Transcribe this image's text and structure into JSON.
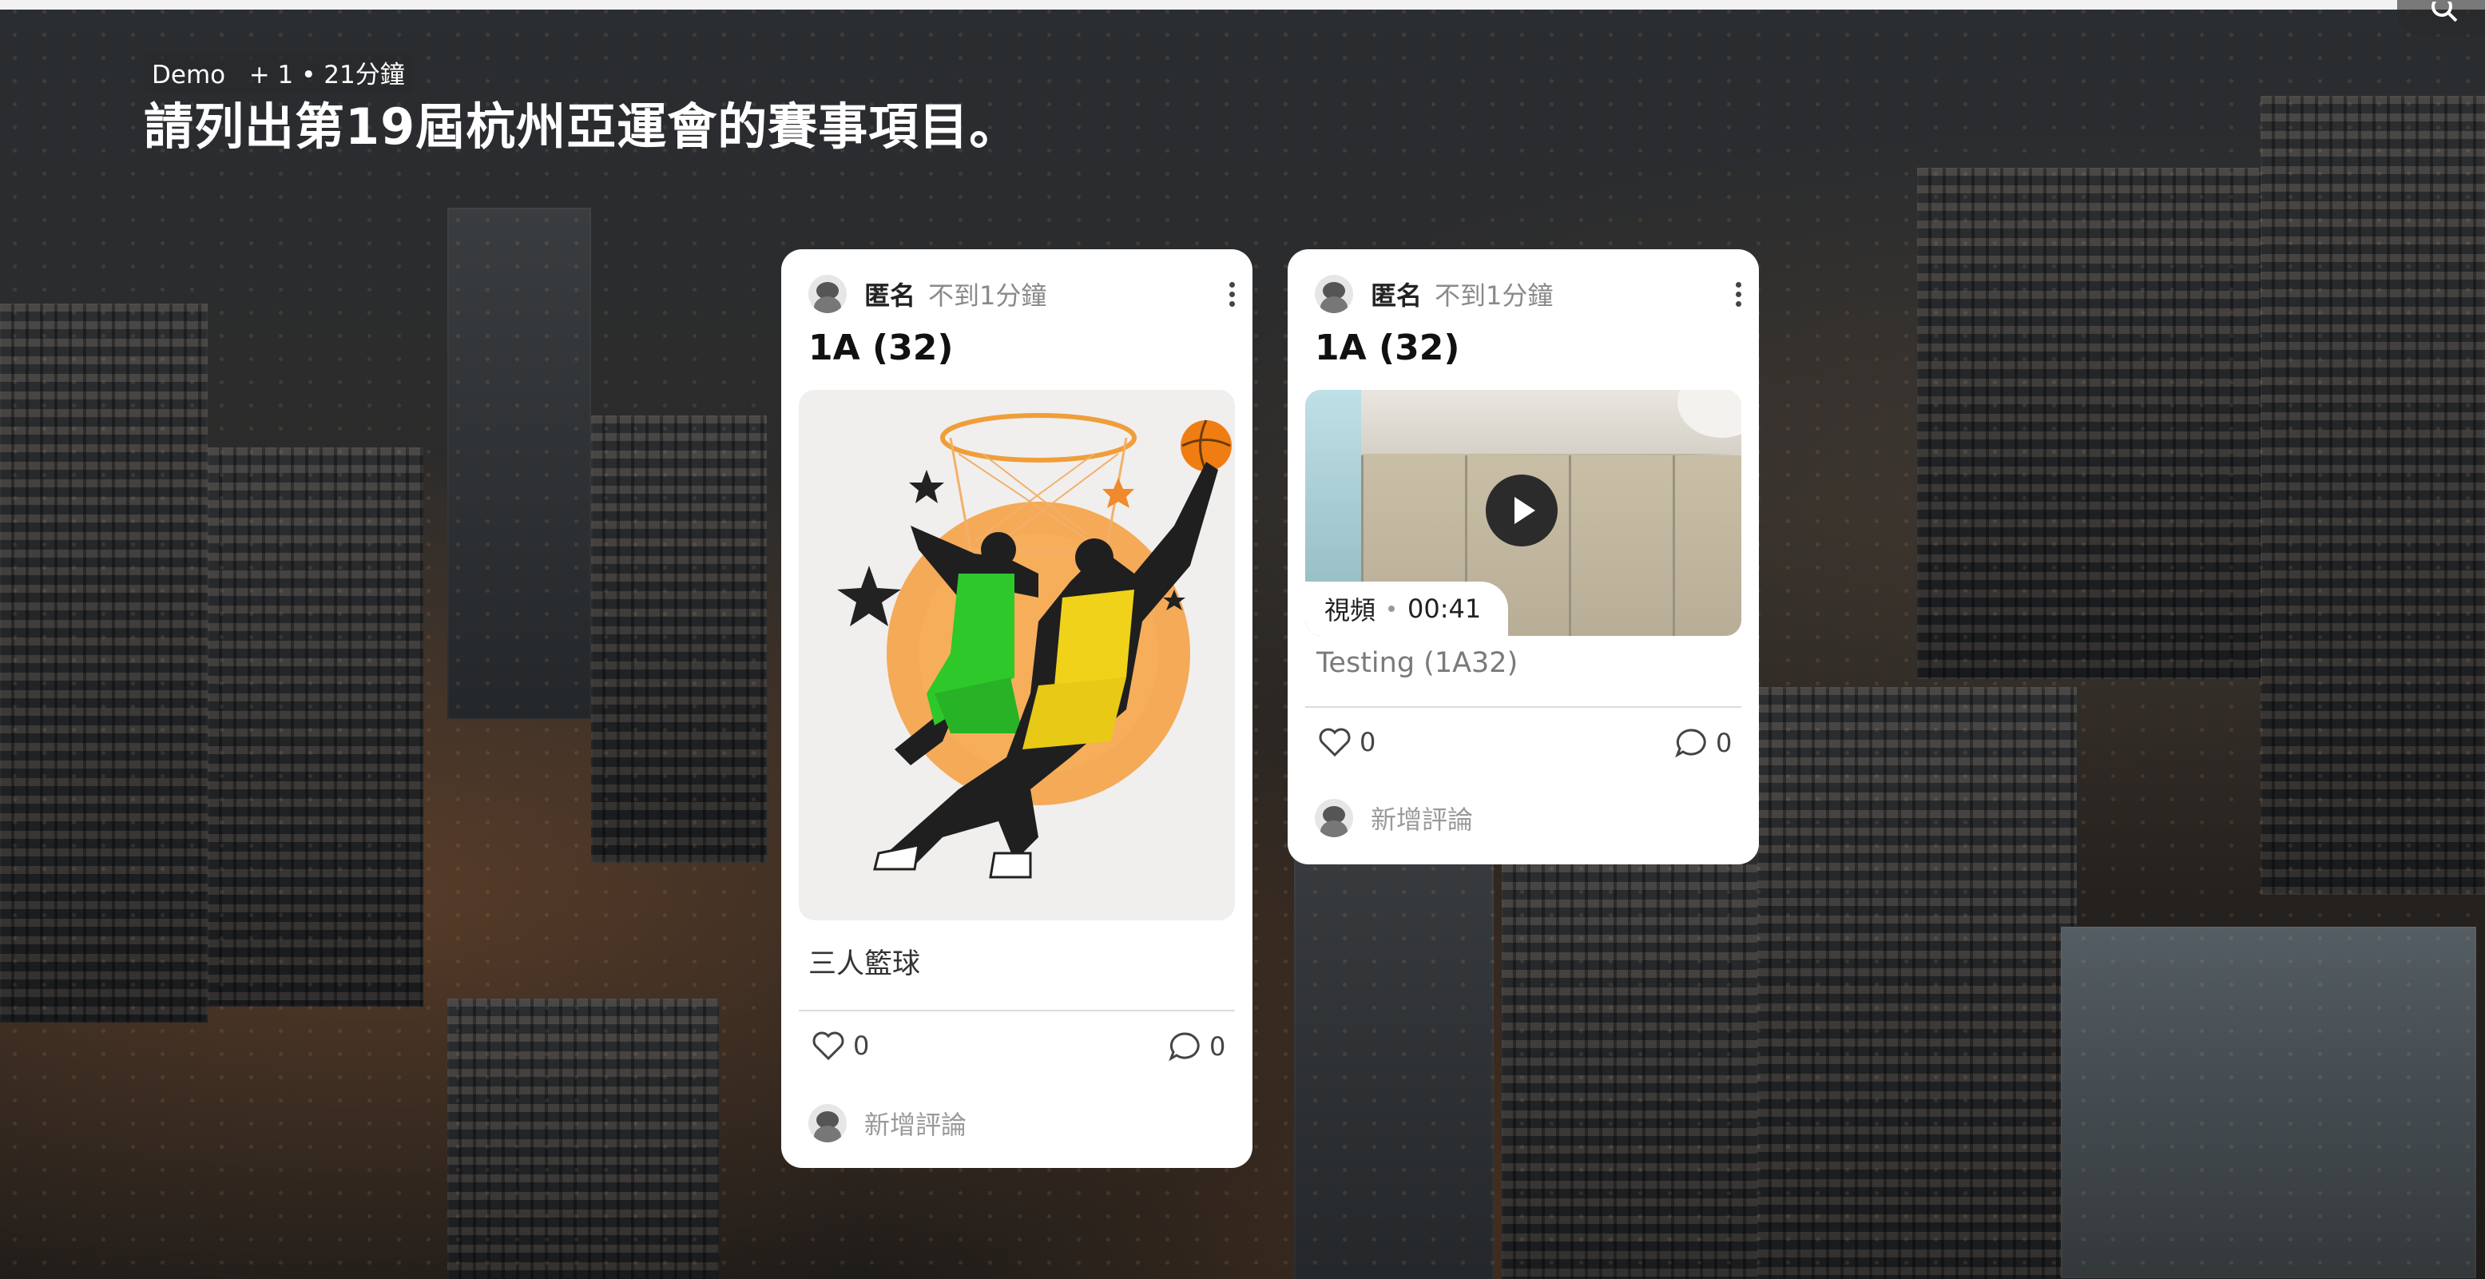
{
  "header": {
    "author": "Demo",
    "extra": "+ 1",
    "time": "21分鐘",
    "title": "請列出第19屆杭州亞運會的賽事項目。"
  },
  "cards": [
    {
      "author": "匿名",
      "time": "不到1分鐘",
      "title": "1A (32)",
      "caption": "三人籃球",
      "likes": "0",
      "comments": "0",
      "add_comment": "新增評論"
    },
    {
      "author": "匿名",
      "time": "不到1分鐘",
      "title": "1A (32)",
      "video_label": "視頻",
      "video_duration": "00:41",
      "caption": "Testing (1A32)",
      "likes": "0",
      "comments": "0",
      "add_comment": "新增評論"
    }
  ],
  "icons": {
    "search": "search-icon",
    "more": "more-vertical-icon",
    "like": "heart-icon",
    "comment": "comment-bubble-icon",
    "play": "play-icon"
  }
}
